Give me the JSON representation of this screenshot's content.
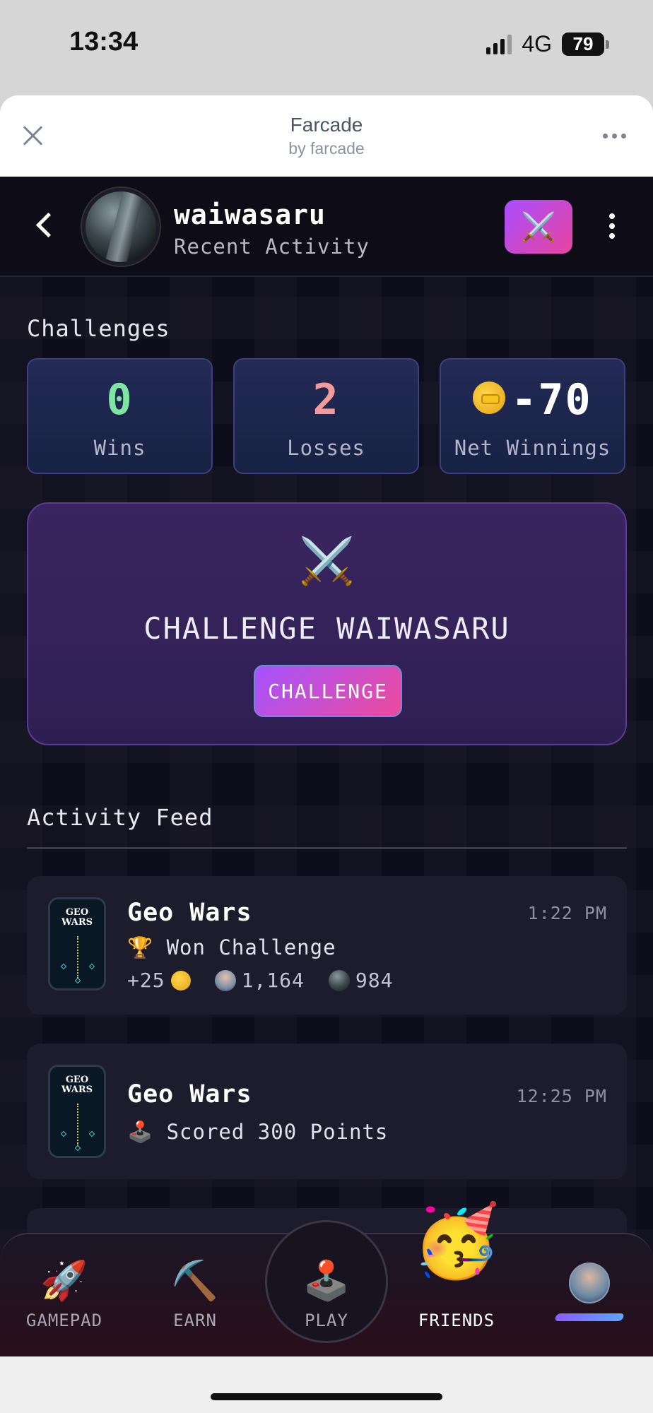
{
  "status_bar": {
    "time": "13:34",
    "network": "4G",
    "battery": "79"
  },
  "sheet": {
    "title": "Farcade",
    "subtitle": "by farcade"
  },
  "profile": {
    "username": "waiwasaru",
    "subtitle": "Recent Activity",
    "challenge_icon": "⚔️"
  },
  "challenges": {
    "title": "Challenges",
    "stats": [
      {
        "value": "0",
        "label": "Wins",
        "color": "#7ee6a2"
      },
      {
        "value": "2",
        "label": "Losses",
        "color": "#f39a9a"
      },
      {
        "value": "-70",
        "label": "Net Winnings",
        "color": "#ffffff"
      }
    ]
  },
  "challenge_card": {
    "icon": "⚔️",
    "title": "CHALLENGE WAIWASARU",
    "button": "CHALLENGE"
  },
  "activity": {
    "title": "Activity Feed",
    "items": [
      {
        "game": "Geo Wars",
        "thumb_title": "GEO WARS",
        "time": "1:22 PM",
        "action_icon": "🏆",
        "action": "Won Challenge",
        "reward": "+25",
        "score_a": "1,164",
        "score_b": "984"
      },
      {
        "game": "Geo Wars",
        "thumb_title": "GEO WARS",
        "time": "12:25 PM",
        "action_icon": "🕹️",
        "action": "Scored 300 Points"
      }
    ]
  },
  "tabs": [
    {
      "label": "GAMEPAD",
      "icon": "🚀"
    },
    {
      "label": "EARN",
      "icon": "⛏️"
    },
    {
      "label": "PLAY",
      "icon": "🕹️"
    },
    {
      "label": "FRIENDS",
      "icon": "🥳"
    },
    {
      "label": "",
      "icon": "avatar"
    }
  ]
}
